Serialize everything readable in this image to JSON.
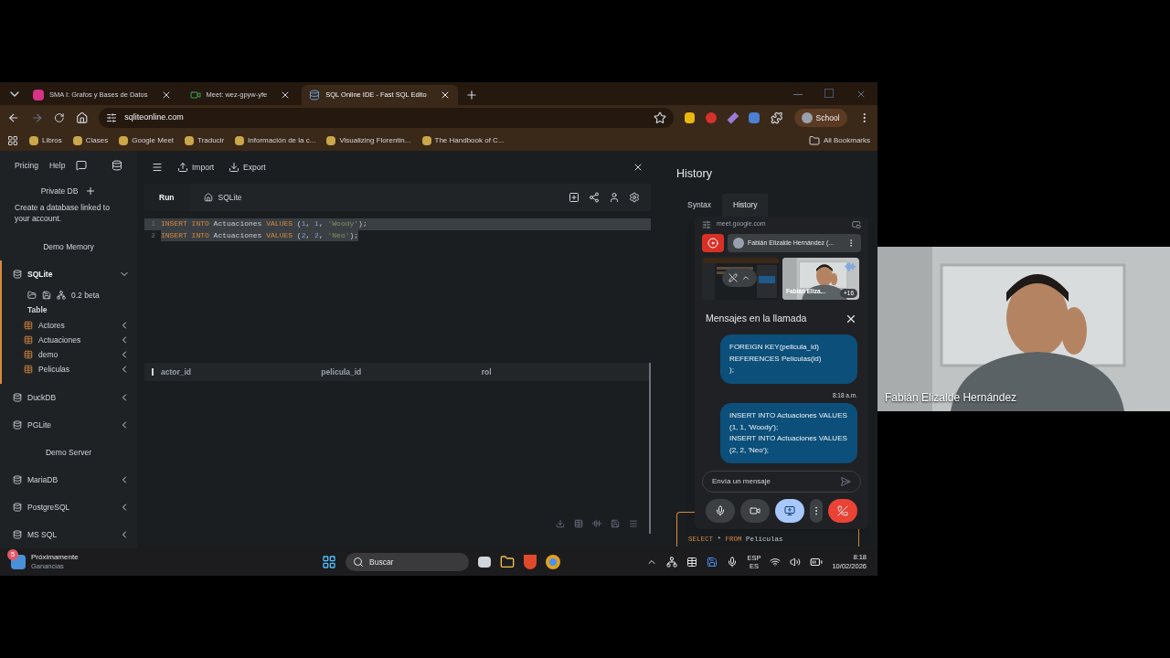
{
  "browser": {
    "tabs": [
      {
        "title": "SMA I: Grafos y Bases de Datos",
        "selected": false,
        "kind": "doc"
      },
      {
        "title": "Meet: wez-gpyw-yfe",
        "selected": false,
        "kind": "meet"
      },
      {
        "title": "SQL Online IDE - Fast SQL Edito",
        "selected": true,
        "kind": "sql"
      }
    ],
    "address": "sqliteonline.com",
    "profile": "School",
    "bookmarks": [
      "Libros",
      "Clases",
      "Google Meet",
      "Traducir",
      "Información de la c...",
      "Visualizing Florentin...",
      "The Handbook of C..."
    ],
    "all_bookmarks": "All Bookmarks"
  },
  "sidebar": {
    "links": [
      "Pricing",
      "Help"
    ],
    "private_db": "Private DB",
    "description": "Create a database linked to your account.",
    "groups": [
      {
        "heading": "Demo Memory",
        "engines": [
          {
            "name": "SQLite",
            "selected": true,
            "expanded": true,
            "version": "0.2 beta",
            "table_heading": "Table",
            "tables": [
              "Actores",
              "Actuaciones",
              "demo",
              "Peliculas"
            ]
          },
          {
            "name": "DuckDB",
            "selected": false,
            "expanded": false
          },
          {
            "name": "PGLite",
            "selected": false,
            "expanded": false
          }
        ]
      },
      {
        "heading": "Demo Server",
        "engines": [
          {
            "name": "MariaDB",
            "selected": false,
            "expanded": false
          },
          {
            "name": "PostgreSQL",
            "selected": false,
            "expanded": false
          },
          {
            "name": "MS SQL",
            "selected": false,
            "expanded": false
          }
        ]
      }
    ]
  },
  "editor": {
    "toolbar": [
      "Import",
      "Export"
    ],
    "run": "Run",
    "db_tab": "SQLite",
    "lines": [
      {
        "number": "1",
        "selected": true,
        "tokens": [
          {
            "kind": "keyword",
            "text": "INSERT INTO"
          },
          {
            "kind": "ident",
            "text": " Actuaciones "
          },
          {
            "kind": "keyword",
            "text": "VALUES"
          },
          {
            "kind": "punct",
            "text": " ("
          },
          {
            "kind": "number",
            "text": "1"
          },
          {
            "kind": "punct",
            "text": ", "
          },
          {
            "kind": "number",
            "text": "1"
          },
          {
            "kind": "punct",
            "text": ", "
          },
          {
            "kind": "string",
            "text": "'Woody'"
          },
          {
            "kind": "punct",
            "text": ");"
          }
        ]
      },
      {
        "number": "2",
        "selected": true,
        "tokens": [
          {
            "kind": "keyword",
            "text": "INSERT INTO"
          },
          {
            "kind": "ident",
            "text": " Actuaciones "
          },
          {
            "kind": "keyword",
            "text": "VALUES"
          },
          {
            "kind": "punct",
            "text": " ("
          },
          {
            "kind": "number",
            "text": "2"
          },
          {
            "kind": "punct",
            "text": ", "
          },
          {
            "kind": "number",
            "text": "2"
          },
          {
            "kind": "punct",
            "text": ", "
          },
          {
            "kind": "string",
            "text": "'Neo'"
          },
          {
            "kind": "punct",
            "text": ");"
          }
        ]
      }
    ],
    "columns": [
      "actor_id",
      "pelicula_id",
      "rol"
    ]
  },
  "history": {
    "title": "History",
    "tabs": [
      {
        "label": "Syntax",
        "selected": false
      },
      {
        "label": "History",
        "selected": true
      }
    ],
    "last_entry": [
      {
        "kind": "keyword",
        "text": "SELECT"
      },
      {
        "kind": "ident",
        "text": " * "
      },
      {
        "kind": "keyword",
        "text": "FROM"
      },
      {
        "kind": "ident",
        "text": " Peliculas"
      }
    ]
  },
  "meet": {
    "url": "meet.google.com",
    "presenter": "Fabián Elizalde Hernández (...",
    "tile_name": "Fabián Eliza...",
    "others": "+16",
    "chat_title": "Mensajes en la llamada",
    "time": "8:18 a.m.",
    "messages": [
      {
        "lines": [
          "FOREIGN KEY(pelicula_id)",
          "REFERENCES Peliculas(id)",
          ");"
        ]
      },
      {
        "lines": [
          "INSERT INTO Actuaciones VALUES",
          "(1, 1, 'Woody');",
          "INSERT INTO Actuaciones VALUES",
          "(2, 2, 'Neo');"
        ]
      }
    ],
    "placeholder": "Envía un mensaje",
    "controls": [
      {
        "kind": "mic",
        "selected": false
      },
      {
        "kind": "camera",
        "selected": false
      },
      {
        "kind": "present",
        "selected": true
      },
      {
        "kind": "more",
        "selected": false
      },
      {
        "kind": "hangup",
        "selected": false
      }
    ]
  },
  "taskbar": {
    "widget_badge": "5",
    "widget_title": "Próximamente",
    "widget_subtitle": "Ganancias",
    "search": "Buscar",
    "lang": "ESP",
    "region": "ES",
    "time": "8:18",
    "date": "10/02/2026"
  },
  "video": {
    "name": "Fabián Elizalde Hernández"
  }
}
